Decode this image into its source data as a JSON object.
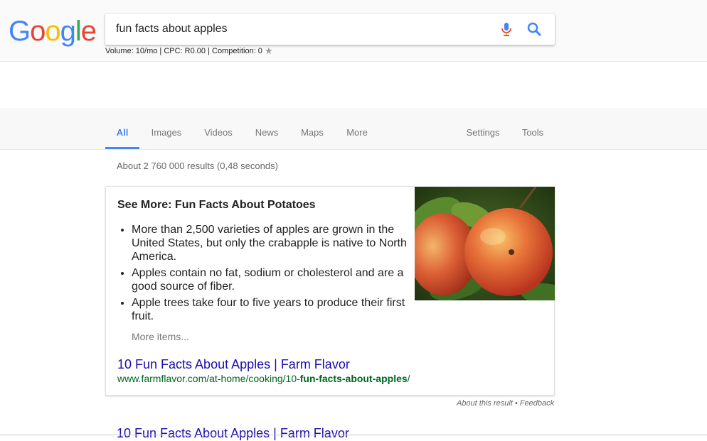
{
  "header": {
    "logo_letters": [
      {
        "char": "G",
        "color": "#4285f4"
      },
      {
        "char": "o",
        "color": "#ea4335"
      },
      {
        "char": "o",
        "color": "#fbbc05"
      },
      {
        "char": "g",
        "color": "#4285f4"
      },
      {
        "char": "l",
        "color": "#34a853"
      },
      {
        "char": "e",
        "color": "#ea4335"
      }
    ],
    "search_value": "fun facts about apples",
    "seo_info": "Volume: 10/mo | CPC: R0.00 | Competition: 0"
  },
  "tabs": [
    {
      "label": "All",
      "active": true
    },
    {
      "label": "Images"
    },
    {
      "label": "Videos"
    },
    {
      "label": "News"
    },
    {
      "label": "Maps"
    },
    {
      "label": "More"
    },
    {
      "label": "Settings"
    },
    {
      "label": "Tools"
    }
  ],
  "result_stats": "About 2 760 000 results (0,48 seconds)",
  "snippet": {
    "title": "See More: Fun Facts About Potatoes",
    "items": [
      "More than 2,500 varieties of apples are grown in the United States, but only the crabapple is native to North America.",
      "Apples contain no fat, sodium or cholesterol and are a good source of fiber.",
      "Apple trees take four to five years to produce their first fruit."
    ],
    "more_items": "More items...",
    "result_title": "10 Fun Facts About Apples | Farm Flavor",
    "url_prefix": "www.farmflavor.com/at-home/cooking/10-",
    "url_bold": "fun-facts-about-apples",
    "url_suffix": "/"
  },
  "about_line": "About this result • Feedback",
  "next_result_title": "10 Fun Facts About Apples | Farm Flavor",
  "colors": {
    "link": "#1a0dab",
    "url": "#006621",
    "accent": "#4285f4"
  }
}
